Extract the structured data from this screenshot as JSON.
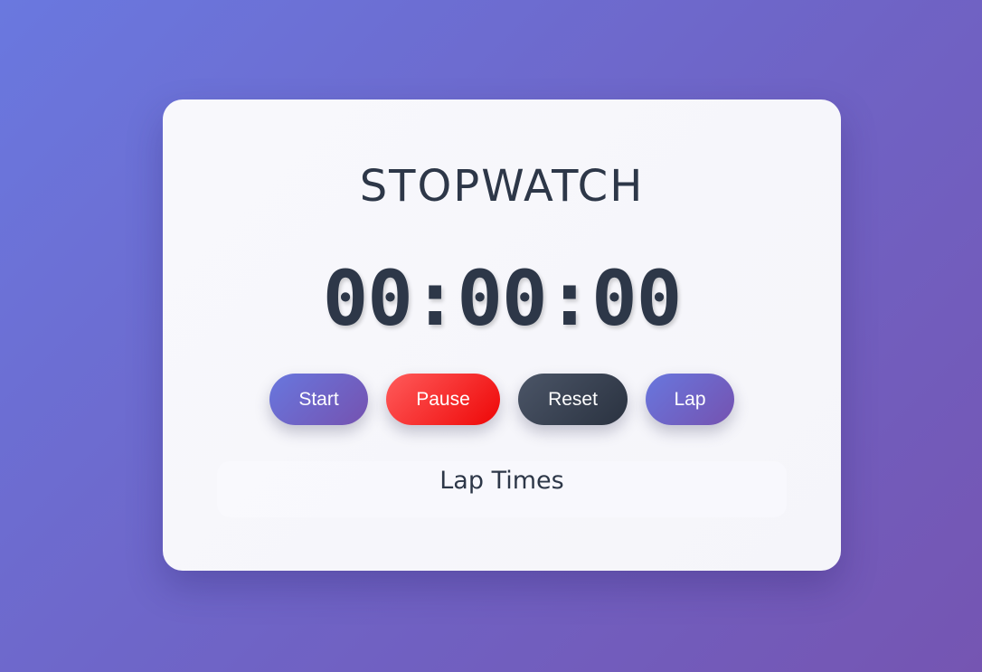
{
  "app": {
    "title": "STOPWATCH"
  },
  "display": {
    "time": "00:00:00"
  },
  "controls": {
    "start_label": "Start",
    "pause_label": "Pause",
    "reset_label": "Reset",
    "lap_label": "Lap"
  },
  "laps": {
    "heading": "Lap Times",
    "items": []
  },
  "colors": {
    "text": "#2d3748",
    "accent_start": "#6877de",
    "accent_end": "#7552b0",
    "pause": "#ff3b3b",
    "reset": "#3a4352"
  }
}
